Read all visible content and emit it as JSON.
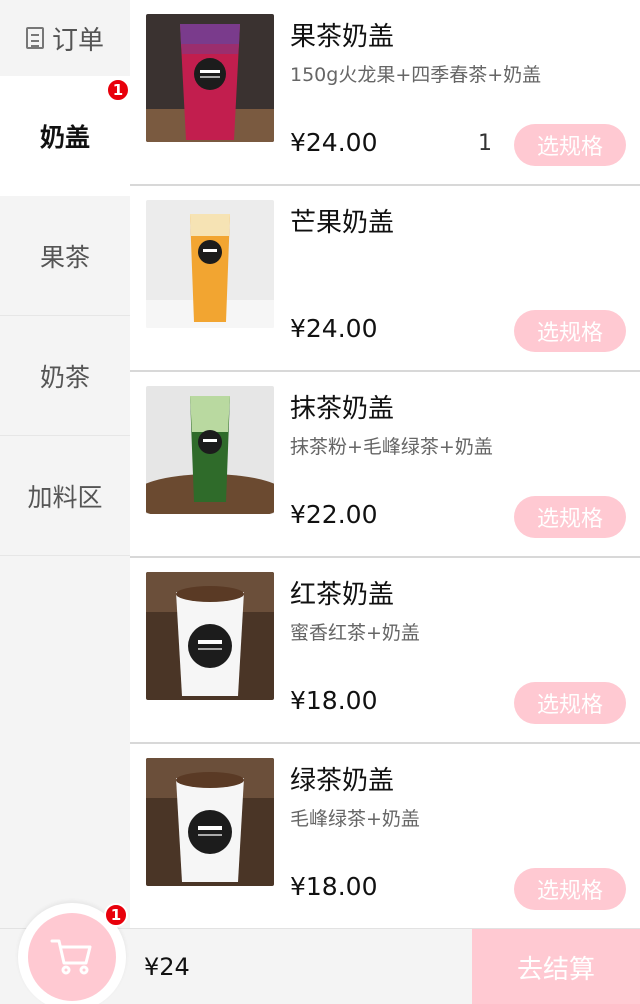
{
  "sidebar": {
    "order_label": "订单",
    "categories": [
      {
        "label": "奶盖",
        "badge": "1"
      },
      {
        "label": "果茶"
      },
      {
        "label": "奶茶"
      },
      {
        "label": "加料区"
      }
    ]
  },
  "products": [
    {
      "name": "果茶奶盖",
      "desc": "150g火龙果+四季春茶+奶盖",
      "price": "¥24.00",
      "qty": "1",
      "button": "选规格"
    },
    {
      "name": "芒果奶盖",
      "desc": "",
      "price": "¥24.00",
      "button": "选规格"
    },
    {
      "name": "抹茶奶盖",
      "desc": "抹茶粉+毛峰绿茶+奶盖",
      "price": "¥22.00",
      "button": "选规格"
    },
    {
      "name": "红茶奶盖",
      "desc": "蜜香红茶+奶盖",
      "price": "¥18.00",
      "button": "选规格"
    },
    {
      "name": "绿茶奶盖",
      "desc": "毛峰绿茶+奶盖",
      "price": "¥18.00",
      "button": "选规格"
    }
  ],
  "cart": {
    "badge": "1",
    "total": "¥24",
    "checkout_label": "去结算"
  },
  "colors": {
    "accent_pink": "#ffc9d2",
    "badge_red": "#e8000b"
  }
}
